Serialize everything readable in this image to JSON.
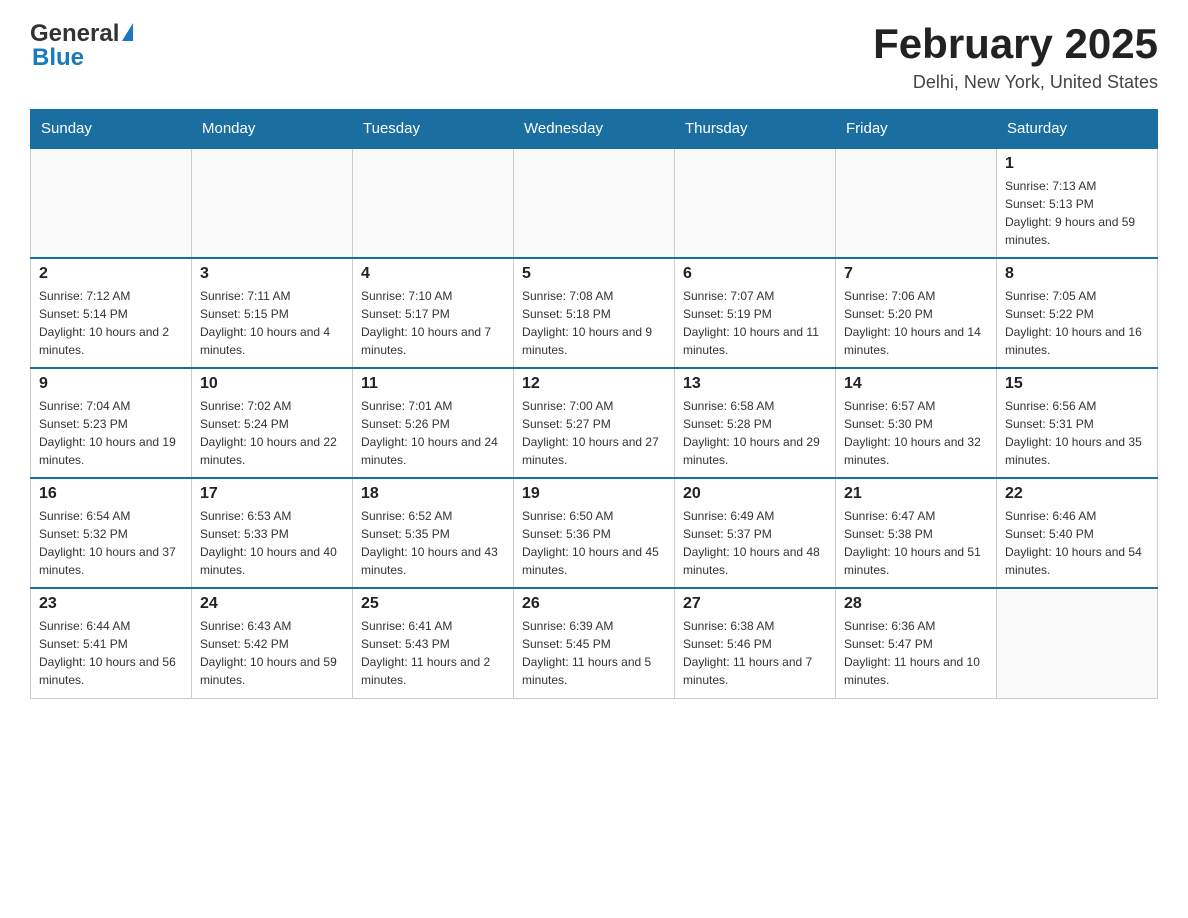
{
  "header": {
    "logo_general": "General",
    "logo_blue": "Blue",
    "title": "February 2025",
    "subtitle": "Delhi, New York, United States"
  },
  "weekdays": [
    "Sunday",
    "Monday",
    "Tuesday",
    "Wednesday",
    "Thursday",
    "Friday",
    "Saturday"
  ],
  "rows": [
    [
      {
        "date": "",
        "info": ""
      },
      {
        "date": "",
        "info": ""
      },
      {
        "date": "",
        "info": ""
      },
      {
        "date": "",
        "info": ""
      },
      {
        "date": "",
        "info": ""
      },
      {
        "date": "",
        "info": ""
      },
      {
        "date": "1",
        "info": "Sunrise: 7:13 AM\nSunset: 5:13 PM\nDaylight: 9 hours and 59 minutes."
      }
    ],
    [
      {
        "date": "2",
        "info": "Sunrise: 7:12 AM\nSunset: 5:14 PM\nDaylight: 10 hours and 2 minutes."
      },
      {
        "date": "3",
        "info": "Sunrise: 7:11 AM\nSunset: 5:15 PM\nDaylight: 10 hours and 4 minutes."
      },
      {
        "date": "4",
        "info": "Sunrise: 7:10 AM\nSunset: 5:17 PM\nDaylight: 10 hours and 7 minutes."
      },
      {
        "date": "5",
        "info": "Sunrise: 7:08 AM\nSunset: 5:18 PM\nDaylight: 10 hours and 9 minutes."
      },
      {
        "date": "6",
        "info": "Sunrise: 7:07 AM\nSunset: 5:19 PM\nDaylight: 10 hours and 11 minutes."
      },
      {
        "date": "7",
        "info": "Sunrise: 7:06 AM\nSunset: 5:20 PM\nDaylight: 10 hours and 14 minutes."
      },
      {
        "date": "8",
        "info": "Sunrise: 7:05 AM\nSunset: 5:22 PM\nDaylight: 10 hours and 16 minutes."
      }
    ],
    [
      {
        "date": "9",
        "info": "Sunrise: 7:04 AM\nSunset: 5:23 PM\nDaylight: 10 hours and 19 minutes."
      },
      {
        "date": "10",
        "info": "Sunrise: 7:02 AM\nSunset: 5:24 PM\nDaylight: 10 hours and 22 minutes."
      },
      {
        "date": "11",
        "info": "Sunrise: 7:01 AM\nSunset: 5:26 PM\nDaylight: 10 hours and 24 minutes."
      },
      {
        "date": "12",
        "info": "Sunrise: 7:00 AM\nSunset: 5:27 PM\nDaylight: 10 hours and 27 minutes."
      },
      {
        "date": "13",
        "info": "Sunrise: 6:58 AM\nSunset: 5:28 PM\nDaylight: 10 hours and 29 minutes."
      },
      {
        "date": "14",
        "info": "Sunrise: 6:57 AM\nSunset: 5:30 PM\nDaylight: 10 hours and 32 minutes."
      },
      {
        "date": "15",
        "info": "Sunrise: 6:56 AM\nSunset: 5:31 PM\nDaylight: 10 hours and 35 minutes."
      }
    ],
    [
      {
        "date": "16",
        "info": "Sunrise: 6:54 AM\nSunset: 5:32 PM\nDaylight: 10 hours and 37 minutes."
      },
      {
        "date": "17",
        "info": "Sunrise: 6:53 AM\nSunset: 5:33 PM\nDaylight: 10 hours and 40 minutes."
      },
      {
        "date": "18",
        "info": "Sunrise: 6:52 AM\nSunset: 5:35 PM\nDaylight: 10 hours and 43 minutes."
      },
      {
        "date": "19",
        "info": "Sunrise: 6:50 AM\nSunset: 5:36 PM\nDaylight: 10 hours and 45 minutes."
      },
      {
        "date": "20",
        "info": "Sunrise: 6:49 AM\nSunset: 5:37 PM\nDaylight: 10 hours and 48 minutes."
      },
      {
        "date": "21",
        "info": "Sunrise: 6:47 AM\nSunset: 5:38 PM\nDaylight: 10 hours and 51 minutes."
      },
      {
        "date": "22",
        "info": "Sunrise: 6:46 AM\nSunset: 5:40 PM\nDaylight: 10 hours and 54 minutes."
      }
    ],
    [
      {
        "date": "23",
        "info": "Sunrise: 6:44 AM\nSunset: 5:41 PM\nDaylight: 10 hours and 56 minutes."
      },
      {
        "date": "24",
        "info": "Sunrise: 6:43 AM\nSunset: 5:42 PM\nDaylight: 10 hours and 59 minutes."
      },
      {
        "date": "25",
        "info": "Sunrise: 6:41 AM\nSunset: 5:43 PM\nDaylight: 11 hours and 2 minutes."
      },
      {
        "date": "26",
        "info": "Sunrise: 6:39 AM\nSunset: 5:45 PM\nDaylight: 11 hours and 5 minutes."
      },
      {
        "date": "27",
        "info": "Sunrise: 6:38 AM\nSunset: 5:46 PM\nDaylight: 11 hours and 7 minutes."
      },
      {
        "date": "28",
        "info": "Sunrise: 6:36 AM\nSunset: 5:47 PM\nDaylight: 11 hours and 10 minutes."
      },
      {
        "date": "",
        "info": ""
      }
    ]
  ]
}
